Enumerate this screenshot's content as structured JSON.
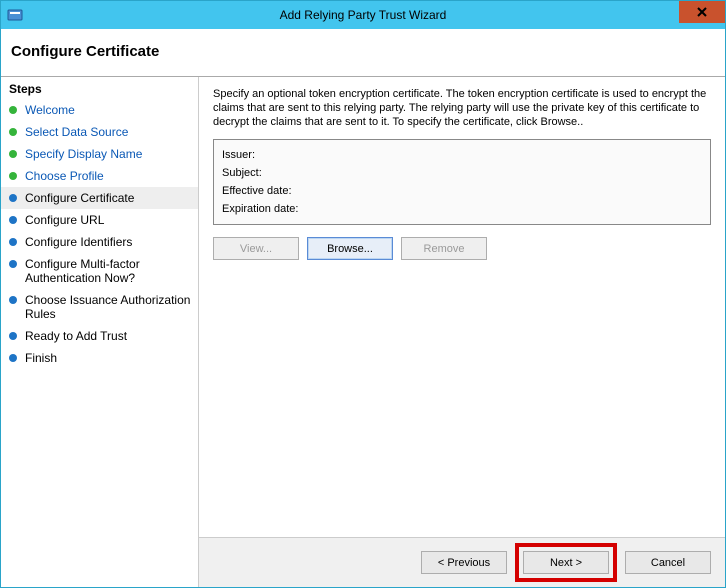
{
  "window": {
    "title": "Add Relying Party Trust Wizard",
    "close_icon": "close"
  },
  "header": {
    "title": "Configure Certificate"
  },
  "sidebar": {
    "header": "Steps",
    "steps": [
      {
        "label": "Welcome",
        "state": "done",
        "link": true
      },
      {
        "label": "Select Data Source",
        "state": "done",
        "link": true
      },
      {
        "label": "Specify Display Name",
        "state": "done",
        "link": true
      },
      {
        "label": "Choose Profile",
        "state": "done",
        "link": true
      },
      {
        "label": "Configure Certificate",
        "state": "current",
        "link": false
      },
      {
        "label": "Configure URL",
        "state": "upcoming",
        "link": false
      },
      {
        "label": "Configure Identifiers",
        "state": "upcoming",
        "link": false
      },
      {
        "label": "Configure Multi-factor Authentication Now?",
        "state": "upcoming",
        "link": false
      },
      {
        "label": "Choose Issuance Authorization Rules",
        "state": "upcoming",
        "link": false
      },
      {
        "label": "Ready to Add Trust",
        "state": "upcoming",
        "link": false
      },
      {
        "label": "Finish",
        "state": "upcoming",
        "link": false
      }
    ]
  },
  "content": {
    "instructions": "Specify an optional token encryption certificate.  The token encryption certificate is used to encrypt the claims that are sent to this relying party.  The relying party will use the private key of this certificate to decrypt the claims that are sent to it.  To specify the certificate, click Browse..",
    "cert": {
      "issuer_label": "Issuer:",
      "subject_label": "Subject:",
      "effective_label": "Effective date:",
      "expiration_label": "Expiration date:"
    },
    "buttons": {
      "view": "View...",
      "browse": "Browse...",
      "remove": "Remove"
    }
  },
  "footer": {
    "previous": "< Previous",
    "next": "Next >",
    "cancel": "Cancel"
  }
}
